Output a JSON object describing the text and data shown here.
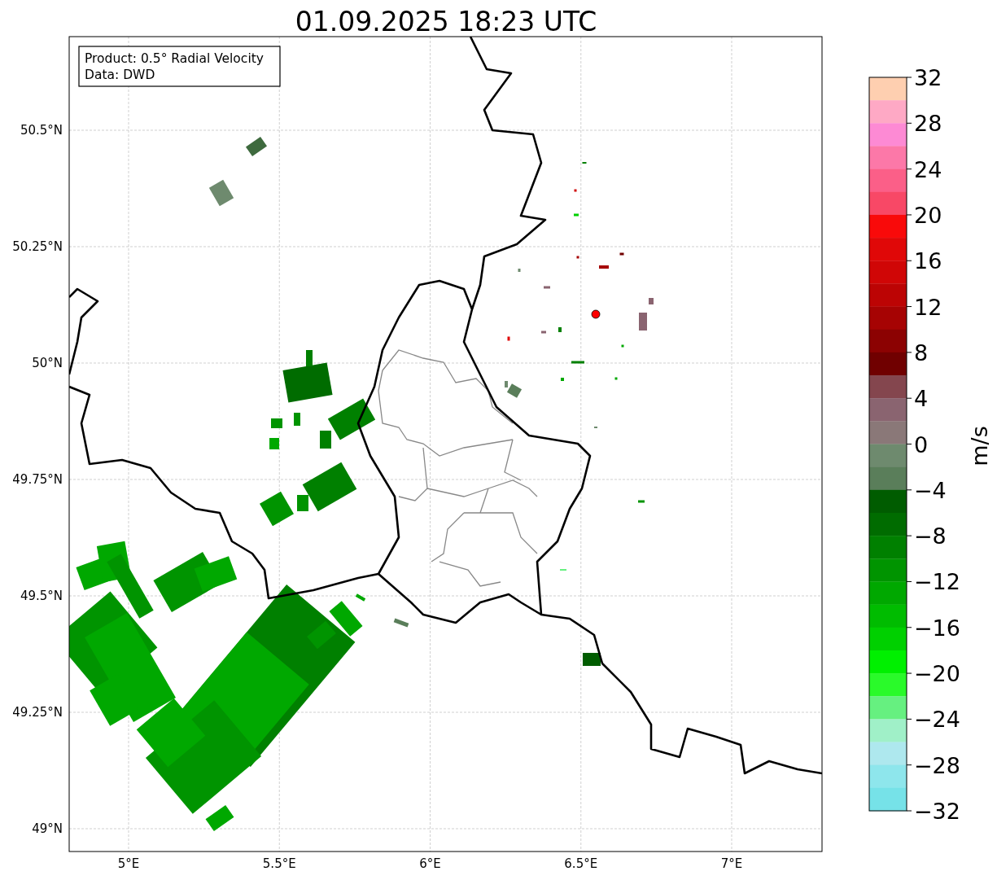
{
  "title": "01.09.2025 18:23 UTC",
  "legend": [
    "Product: 0.5° Radial Velocity",
    "Data: DWD"
  ],
  "x_ticks": [
    "5°E",
    "5.5°E",
    "6°E",
    "6.5°E",
    "7°E"
  ],
  "y_ticks": [
    "50.5°N",
    "50.25°N",
    "50°N",
    "49.75°N",
    "49.5°N",
    "49.25°N",
    "49°N"
  ],
  "colorbar": {
    "label": "m/s",
    "ticks": [
      "32",
      "28",
      "24",
      "20",
      "16",
      "12",
      "8",
      "4",
      "0",
      "−4",
      "−8",
      "−12",
      "−16",
      "−20",
      "−24",
      "−28",
      "−32"
    ],
    "bins": [
      {
        "color": "#fecfb0"
      },
      {
        "color": "#fea9c5"
      },
      {
        "color": "#fd8ad4"
      },
      {
        "color": "#fc78a8"
      },
      {
        "color": "#fb5f88"
      },
      {
        "color": "#f84866"
      },
      {
        "color": "#f90a0a"
      },
      {
        "color": "#e00808"
      },
      {
        "color": "#d00606"
      },
      {
        "color": "#bc0404"
      },
      {
        "color": "#a60303"
      },
      {
        "color": "#8c0202"
      },
      {
        "color": "#700000"
      },
      {
        "color": "#84464e"
      },
      {
        "color": "#8a6470"
      },
      {
        "color": "#8a7878"
      },
      {
        "color": "#6e8a6e"
      },
      {
        "color": "#5a7e5a"
      },
      {
        "color": "#005c00"
      },
      {
        "color": "#006c00"
      },
      {
        "color": "#008000"
      },
      {
        "color": "#009400"
      },
      {
        "color": "#00a800"
      },
      {
        "color": "#00bc00"
      },
      {
        "color": "#00d000"
      },
      {
        "color": "#00f000"
      },
      {
        "color": "#2afa2a"
      },
      {
        "color": "#66f080"
      },
      {
        "color": "#a0f0c8"
      },
      {
        "color": "#aee8ee"
      },
      {
        "color": "#8ee6ec"
      },
      {
        "color": "#76e2e8"
      }
    ]
  }
}
